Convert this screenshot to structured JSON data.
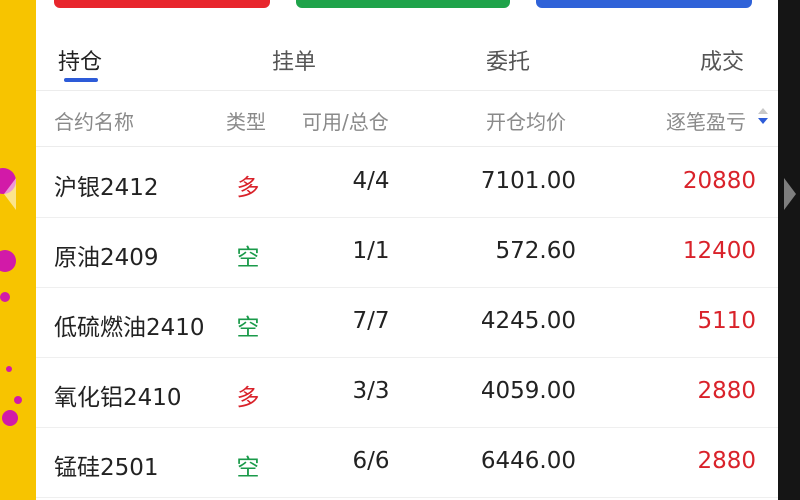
{
  "colors": {
    "long": "#d9222a",
    "short": "#1a9a4a",
    "profit": "#d9222a",
    "accent": "#2d5bd8",
    "promo_bg": "#f7c400",
    "promo_dot": "#d21aa8"
  },
  "action_buttons": [
    {
      "color": "#e8262d"
    },
    {
      "color": "#1fa34a"
    },
    {
      "color": "#2f62d8"
    }
  ],
  "tabs": [
    {
      "label": "持仓",
      "active": true
    },
    {
      "label": "挂单",
      "active": false
    },
    {
      "label": "委托",
      "active": false
    },
    {
      "label": "成交",
      "active": false
    }
  ],
  "table": {
    "headers": {
      "name": "合约名称",
      "type": "类型",
      "qty": "可用/总仓",
      "price": "开仓均价",
      "pnl": "逐笔盈亏"
    },
    "sort_icon": "sort-desc-icon",
    "rows": [
      {
        "name": "沪银2412",
        "type": "多",
        "side": "long",
        "qty": "4/4",
        "price": "7101.00",
        "pnl": "20880"
      },
      {
        "name": "原油2409",
        "type": "空",
        "side": "short",
        "qty": "1/1",
        "price": "572.60",
        "pnl": "12400"
      },
      {
        "name": "低硫燃油2410",
        "type": "空",
        "side": "short",
        "qty": "7/7",
        "price": "4245.00",
        "pnl": "5110"
      },
      {
        "name": "氧化铝2410",
        "type": "多",
        "side": "long",
        "qty": "3/3",
        "price": "4059.00",
        "pnl": "2880"
      },
      {
        "name": "锰硅2501",
        "type": "空",
        "side": "short",
        "qty": "6/6",
        "price": "6446.00",
        "pnl": "2880"
      }
    ]
  }
}
